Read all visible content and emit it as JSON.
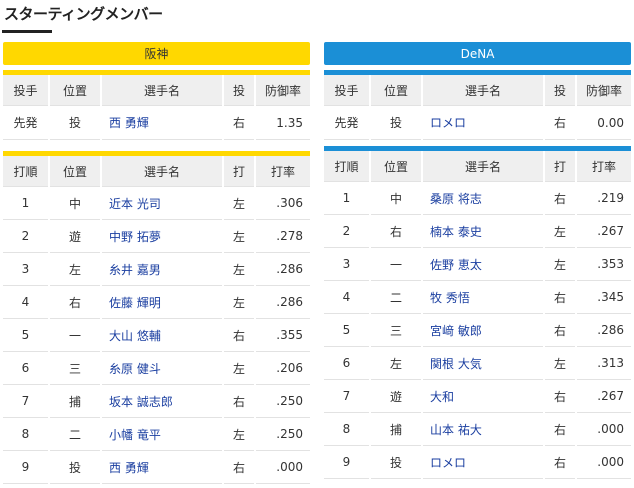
{
  "page": {
    "title": "スターティングメンバー"
  },
  "teams": {
    "hanshin": {
      "name": "阪神",
      "pitcher_headers": [
        "投手",
        "位置",
        "選手名",
        "投",
        "防御率"
      ],
      "pitcher": {
        "role": "先発",
        "pos": "投",
        "name": "西 勇輝",
        "hand": "右",
        "era": "1.35"
      },
      "order_headers": [
        "打順",
        "位置",
        "選手名",
        "打",
        "打率"
      ],
      "lineup": [
        {
          "order": "1",
          "pos": "中",
          "name": "近本 光司",
          "bat": "左",
          "avg": ".306"
        },
        {
          "order": "2",
          "pos": "遊",
          "name": "中野 拓夢",
          "bat": "左",
          "avg": ".278"
        },
        {
          "order": "3",
          "pos": "左",
          "name": "糸井 嘉男",
          "bat": "左",
          "avg": ".286"
        },
        {
          "order": "4",
          "pos": "右",
          "name": "佐藤 輝明",
          "bat": "左",
          "avg": ".286"
        },
        {
          "order": "5",
          "pos": "一",
          "name": "大山 悠輔",
          "bat": "右",
          "avg": ".355"
        },
        {
          "order": "6",
          "pos": "三",
          "name": "糸原 健斗",
          "bat": "左",
          "avg": ".206"
        },
        {
          "order": "7",
          "pos": "捕",
          "name": "坂本 誠志郎",
          "bat": "右",
          "avg": ".250"
        },
        {
          "order": "8",
          "pos": "二",
          "name": "小幡 竜平",
          "bat": "左",
          "avg": ".250"
        },
        {
          "order": "9",
          "pos": "投",
          "name": "西 勇輝",
          "bat": "右",
          "avg": ".000"
        }
      ]
    },
    "dena": {
      "name": "DeNA",
      "pitcher_headers": [
        "投手",
        "位置",
        "選手名",
        "投",
        "防御率"
      ],
      "pitcher": {
        "role": "先発",
        "pos": "投",
        "name": "ロメロ",
        "hand": "右",
        "era": "0.00"
      },
      "order_headers": [
        "打順",
        "位置",
        "選手名",
        "打",
        "打率"
      ],
      "lineup": [
        {
          "order": "1",
          "pos": "中",
          "name": "桑原 将志",
          "bat": "右",
          "avg": ".219"
        },
        {
          "order": "2",
          "pos": "右",
          "name": "楠本 泰史",
          "bat": "左",
          "avg": ".267"
        },
        {
          "order": "3",
          "pos": "一",
          "name": "佐野 恵太",
          "bat": "左",
          "avg": ".353"
        },
        {
          "order": "4",
          "pos": "二",
          "name": "牧 秀悟",
          "bat": "右",
          "avg": ".345"
        },
        {
          "order": "5",
          "pos": "三",
          "name": "宮﨑 敏郎",
          "bat": "右",
          "avg": ".286"
        },
        {
          "order": "6",
          "pos": "左",
          "name": "関根 大気",
          "bat": "左",
          "avg": ".313"
        },
        {
          "order": "7",
          "pos": "遊",
          "name": "大和",
          "bat": "右",
          "avg": ".267"
        },
        {
          "order": "8",
          "pos": "捕",
          "name": "山本 祐大",
          "bat": "右",
          "avg": ".000"
        },
        {
          "order": "9",
          "pos": "投",
          "name": "ロメロ",
          "bat": "右",
          "avg": ".000"
        }
      ]
    }
  },
  "colors": {
    "hanshin": "#ffd800",
    "dena": "#1b8fd6",
    "player_link": "#1a3ea0"
  }
}
